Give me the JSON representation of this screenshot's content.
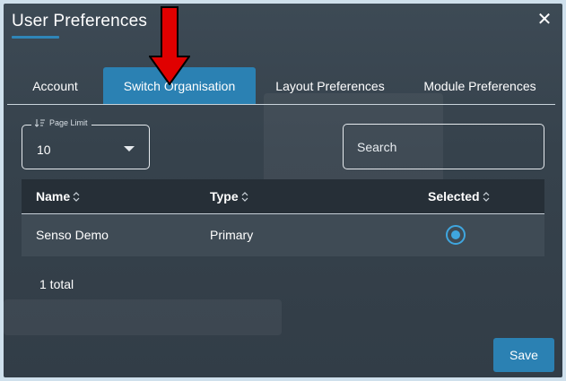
{
  "dialog": {
    "title": "User Preferences",
    "close_icon": "close-icon",
    "close_label": "✕"
  },
  "tabs": [
    {
      "label": "Account",
      "active": false
    },
    {
      "label": "Switch Organisation",
      "active": true
    },
    {
      "label": "Layout Preferences",
      "active": false
    },
    {
      "label": "Module Preferences",
      "active": false
    }
  ],
  "annotation": {
    "icon": "red-arrow-pointer",
    "color": "#e00000"
  },
  "page_limit": {
    "legend": "Page Limit",
    "value": "10",
    "icon": "sort-lines-icon"
  },
  "search": {
    "placeholder": "Search",
    "value": ""
  },
  "table": {
    "columns": [
      "Name",
      "Type",
      "Selected"
    ],
    "rows": [
      {
        "name": "Senso Demo",
        "type": "Primary",
        "selected": true
      }
    ],
    "total": "1 total"
  },
  "footer": {
    "save_label": "Save"
  },
  "colors": {
    "accent": "#2b81b3",
    "radio": "#3fa6df",
    "background": "#36424c"
  }
}
